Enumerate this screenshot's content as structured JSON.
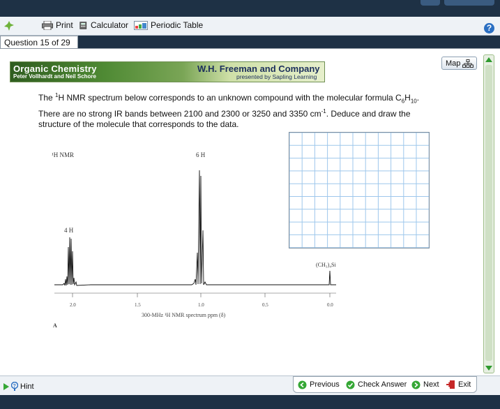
{
  "toolbar": {
    "print": "Print",
    "calculator": "Calculator",
    "periodic_table": "Periodic Table",
    "help": "?"
  },
  "question_tab": "Question 15 of 29",
  "banner": {
    "book_title": "Organic Chemistry",
    "authors": "Peter Vollhardt and Neil Schore",
    "publisher": "W.H. Freeman and Company",
    "presented": "presented by Sapling Learning"
  },
  "map_label": "Map",
  "prompt": {
    "line1_a": "The ",
    "line1_sup": "1",
    "line1_b": "H NMR spectrum below corresponds to an unknown compound with the molecular formula C",
    "line1_sub6": "6",
    "line1_H": "H",
    "line1_sub10": "10",
    "line1_end": ".",
    "line2_a": "There are no strong IR bands between 2100 and 2300 or 3250 and 3350 cm",
    "line2_sup": "-1",
    "line2_b": ". Deduce and draw the",
    "line3": "structure of the molecule that corresponds to the data."
  },
  "spectrum": {
    "label_nmr": "¹H NMR",
    "label_6h": "6 H",
    "label_4h": "4 H",
    "label_tms": "(CH₃)₄Si",
    "ticks": [
      "2.0",
      "1.5",
      "1.0",
      "0.5",
      "0.0"
    ],
    "axis_caption": "300-MHz ¹H NMR spectrum ppm (δ)",
    "panel_letter": "A"
  },
  "nav": {
    "previous": "Previous",
    "check": "Check Answer",
    "next": "Next",
    "exit": "Exit",
    "hint": "Hint"
  },
  "colors": {
    "accent_green": "#35a735",
    "grid_blue": "#9ec7ec",
    "header_navy": "#1e3145"
  }
}
